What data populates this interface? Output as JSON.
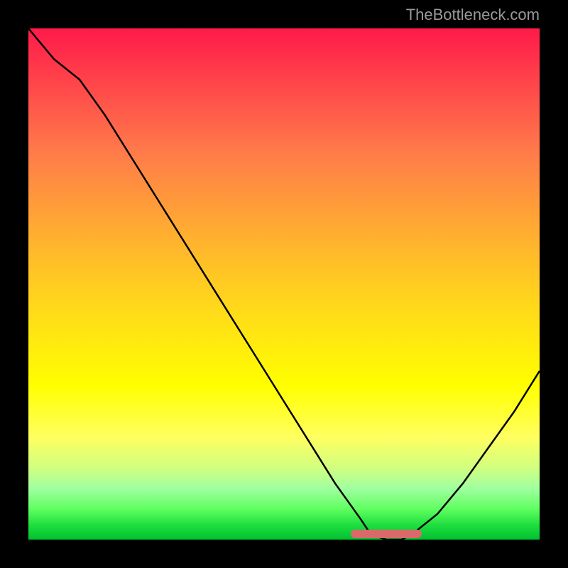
{
  "watermark": "TheBottleneck.com",
  "chart_data": {
    "type": "line",
    "title": "",
    "xlabel": "",
    "ylabel": "",
    "xlim": [
      0,
      100
    ],
    "ylim": [
      0,
      100
    ],
    "x": [
      0,
      5,
      10,
      15,
      20,
      25,
      30,
      35,
      40,
      45,
      50,
      55,
      60,
      65,
      67,
      70,
      73,
      75,
      80,
      85,
      90,
      95,
      100
    ],
    "values": [
      100,
      94,
      90,
      83,
      75,
      67,
      59,
      51,
      43,
      35,
      27,
      19,
      11,
      4,
      1,
      0,
      0,
      1,
      5,
      11,
      18,
      25,
      33
    ],
    "highlight_range": [
      63,
      77
    ],
    "background_gradient": [
      "#ff1a4a",
      "#ff7a4a",
      "#ffda1a",
      "#ffff00",
      "#60ff60",
      "#00c030"
    ]
  }
}
